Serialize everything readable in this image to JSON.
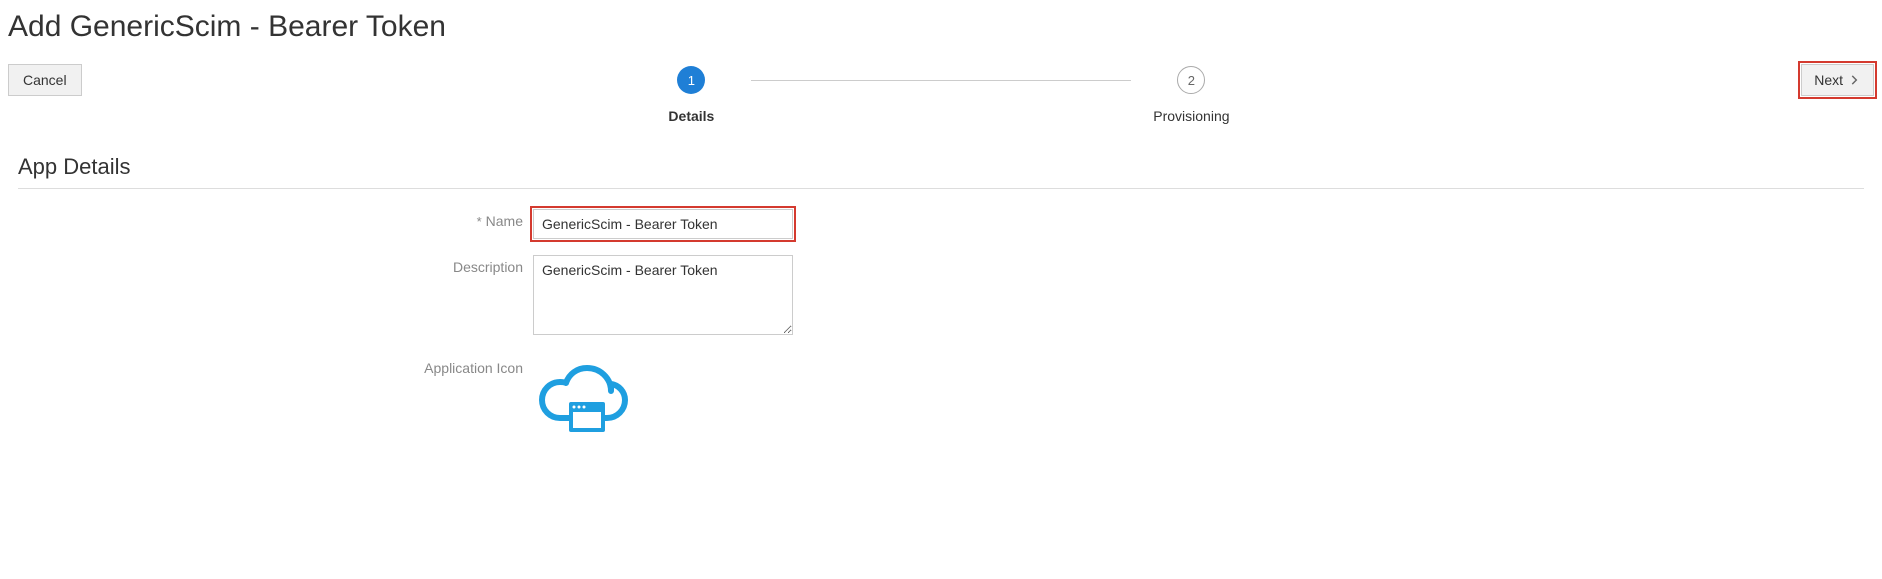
{
  "page": {
    "title": "Add GenericScim - Bearer Token"
  },
  "buttons": {
    "cancel": "Cancel",
    "next": "Next"
  },
  "stepper": {
    "step1": {
      "num": "1",
      "label": "Details"
    },
    "step2": {
      "num": "2",
      "label": "Provisioning"
    }
  },
  "section": {
    "app_details": "App Details"
  },
  "form": {
    "name_label": "Name",
    "name_value": "GenericScim - Bearer Token",
    "description_label": "Description",
    "description_value": "GenericScim - Bearer Token",
    "app_icon_label": "Application Icon",
    "required_star": "*"
  }
}
